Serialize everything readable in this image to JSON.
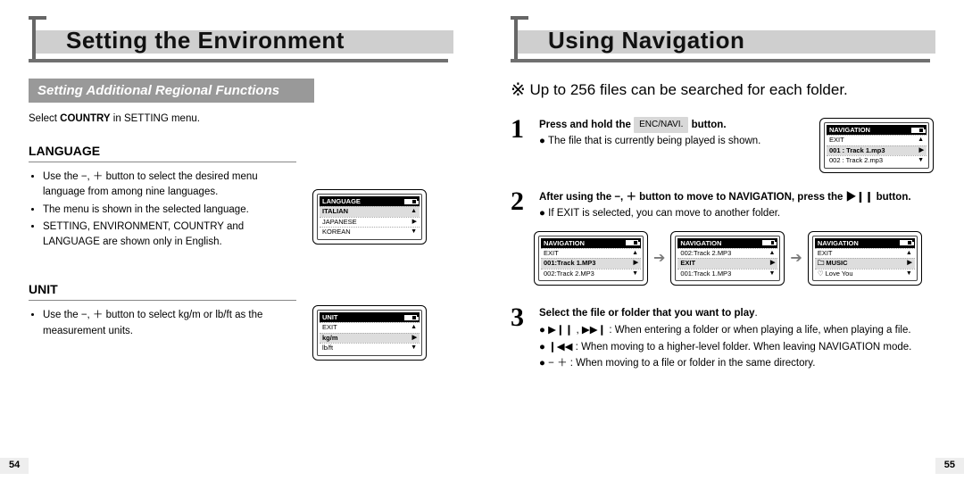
{
  "left": {
    "title": "Setting the Environment",
    "subtitle": "Setting Additional Regional Functions",
    "select_note_pre": "Select ",
    "select_note_bold": "COUNTRY",
    "select_note_post": " in SETTING menu.",
    "section_language": "LANGUAGE",
    "lang_bullets": [
      "Use the −, ＋ button to select the desired menu language  from among nine languages.",
      "The menu is shown in the selected language.",
      "SETTING, ENVIRONMENT, COUNTRY and LANGUAGE are shown only in English."
    ],
    "section_unit": "UNIT",
    "unit_bullets": [
      "Use the −, ＋ button to select kg/m or lb/ft as the measurement units."
    ],
    "lcd_lang": {
      "title": "LANGUAGE",
      "rows": [
        "ITALIAN",
        "JAPANESE",
        "KOREAN"
      ]
    },
    "lcd_unit": {
      "title": "UNIT",
      "rows": [
        "EXIT",
        "kg/m",
        "lb/ft"
      ]
    },
    "page_num": "54"
  },
  "right": {
    "title": "Using Navigation",
    "desc": "Up to 256 files can be searched for each folder.",
    "step1_bold_pre": "Press and hold the ",
    "step1_btn": "ENC/NAVI.",
    "step1_bold_post": " button.",
    "step1_line2": "The file that is currently being played is shown.",
    "step2_bold": "After using the −, ＋ button to move to NAVIGATION, press the ▶❙❙ button.",
    "step2_line2": "If EXIT is selected, you can move to another folder.",
    "step3_bold": "Select the file or folder that you want to play",
    "step3_line2": "▶❙❙ , ▶▶❙ : When entering a folder or when playing a life, when playing a file.",
    "step3_line3": "❙◀◀ : When moving to a higher-level folder. When leaving NAVIGATION mode.",
    "step3_line4": "− ＋ : When moving to a file or folder in the same directory.",
    "lcd_nav1": {
      "title": "NAVIGATION",
      "rows": [
        "EXIT",
        "001 : Track 1.mp3",
        "002 : Track 2.mp3"
      ]
    },
    "lcd_navA": {
      "title": "NAVIGATION",
      "rows": [
        "EXIT",
        "001:Track 1.MP3",
        "002:Track 2.MP3"
      ]
    },
    "lcd_navB": {
      "title": "NAVIGATION",
      "rows": [
        "002:Track 2.MP3",
        "EXIT",
        "001:Track 1.MP3"
      ]
    },
    "lcd_navC": {
      "title": "NAVIGATION",
      "rows": [
        "EXIT",
        "🗀 MUSIC",
        "♡ Love You"
      ]
    },
    "page_num": "55"
  }
}
